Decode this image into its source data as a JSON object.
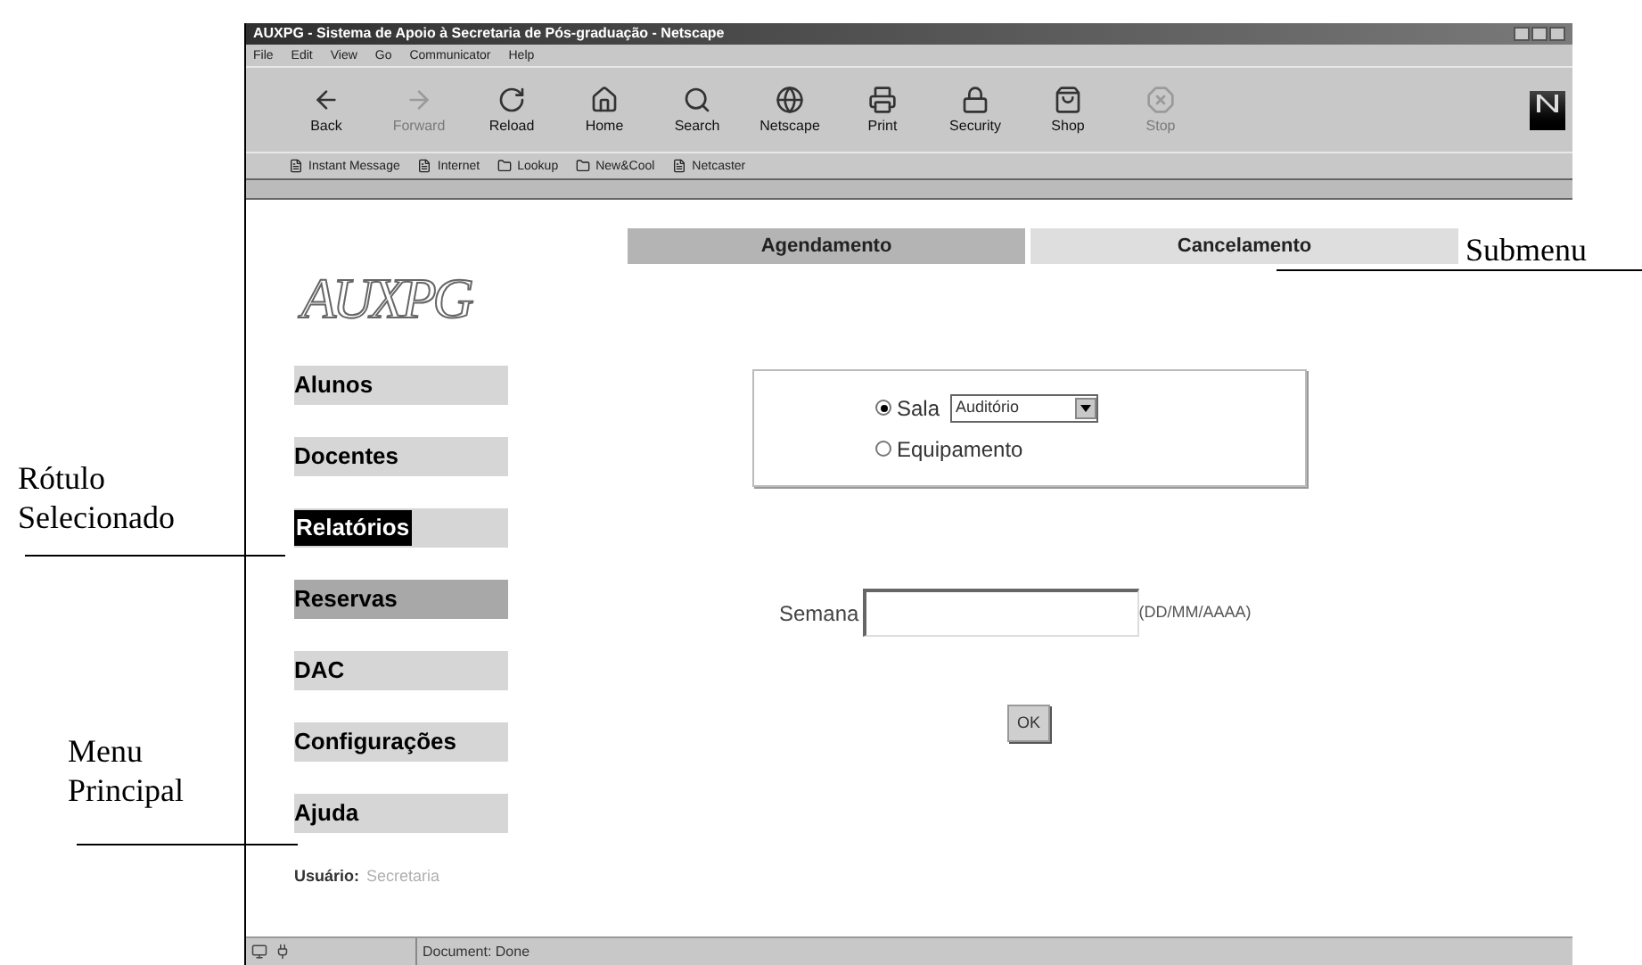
{
  "window": {
    "title": "AUXPG - Sistema de Apoio à Secretaria de Pós-graduação - Netscape"
  },
  "menu_bar": [
    "File",
    "Edit",
    "View",
    "Go",
    "Communicator",
    "Help"
  ],
  "toolbar": [
    {
      "label": "Back",
      "disabled": false
    },
    {
      "label": "Forward",
      "disabled": true
    },
    {
      "label": "Reload",
      "disabled": false
    },
    {
      "label": "Home",
      "disabled": false
    },
    {
      "label": "Search",
      "disabled": false
    },
    {
      "label": "Netscape",
      "disabled": false
    },
    {
      "label": "Print",
      "disabled": false
    },
    {
      "label": "Security",
      "disabled": false
    },
    {
      "label": "Shop",
      "disabled": false
    },
    {
      "label": "Stop",
      "disabled": true
    }
  ],
  "personal_toolbar": [
    {
      "label": "Instant Message",
      "kind": "page"
    },
    {
      "label": "Internet",
      "kind": "page"
    },
    {
      "label": "Lookup",
      "kind": "folder"
    },
    {
      "label": "New&Cool",
      "kind": "folder"
    },
    {
      "label": "Netcaster",
      "kind": "page"
    }
  ],
  "logo": "AUXPG",
  "main_menu": [
    {
      "label": "Alunos",
      "selected": false,
      "current": false
    },
    {
      "label": "Docentes",
      "selected": false,
      "current": false
    },
    {
      "label": "Relatórios",
      "selected": true,
      "current": false
    },
    {
      "label": "Reservas",
      "selected": false,
      "current": true
    },
    {
      "label": "DAC",
      "selected": false,
      "current": false
    },
    {
      "label": "Configurações",
      "selected": false,
      "current": false
    },
    {
      "label": "Ajuda",
      "selected": false,
      "current": false
    }
  ],
  "user": {
    "label": "Usuário:",
    "value": "Secretaria"
  },
  "submenu": [
    {
      "label": "Agendamento",
      "selected": true
    },
    {
      "label": "Cancelamento",
      "selected": false
    }
  ],
  "form": {
    "options": [
      {
        "label": "Sala",
        "selected": true,
        "kind": "select",
        "value": "Auditório"
      },
      {
        "label": "Equipamento",
        "selected": false,
        "kind": "plain"
      }
    ],
    "week": {
      "label": "Semana",
      "hint": "(DD/MM/AAAA)"
    },
    "submit": "OK"
  },
  "status_bar": {
    "text": "Document: Done"
  },
  "annotations": [
    {
      "text": "Rótulo Selecionado",
      "kind": "left-upper"
    },
    {
      "text": "Menu Principal",
      "kind": "left-lower"
    },
    {
      "text": "Submenu",
      "kind": "right-upper"
    }
  ]
}
